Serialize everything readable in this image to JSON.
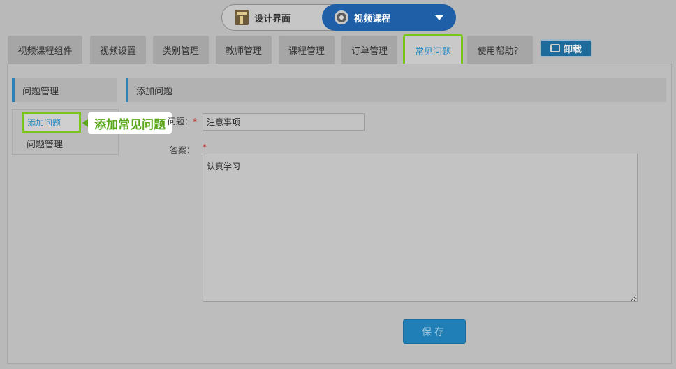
{
  "switcher": {
    "design_label": "设计界面",
    "video_label": "视频课程",
    "design_icon": "design-interface-icon",
    "video_icon": "gear-icon"
  },
  "tabs": [
    {
      "label": "视频课程组件",
      "active": false
    },
    {
      "label": "视频设置",
      "active": false
    },
    {
      "label": "类别管理",
      "active": false
    },
    {
      "label": "教师管理",
      "active": false
    },
    {
      "label": "课程管理",
      "active": false
    },
    {
      "label": "订单管理",
      "active": false
    },
    {
      "label": "常见问题",
      "active": true
    },
    {
      "label": "使用帮助？",
      "active": false
    }
  ],
  "uninstall_label": "卸载",
  "sidebar": {
    "title": "问题管理",
    "items": [
      {
        "label": "添加问题",
        "active": true
      },
      {
        "label": "问题管理",
        "active": false
      }
    ]
  },
  "callout_text": "添加常见问题",
  "main": {
    "title": "添加问题",
    "question_label": "问题：",
    "answer_label": "答案：",
    "required_mark": "*",
    "question_value": "注意事项",
    "answer_value": "认真学习",
    "save_label": "保存"
  },
  "colors": {
    "accent_blue": "#2d83b8",
    "highlight_green": "#7ac51a",
    "switcher_active": "#1e5fa8"
  }
}
